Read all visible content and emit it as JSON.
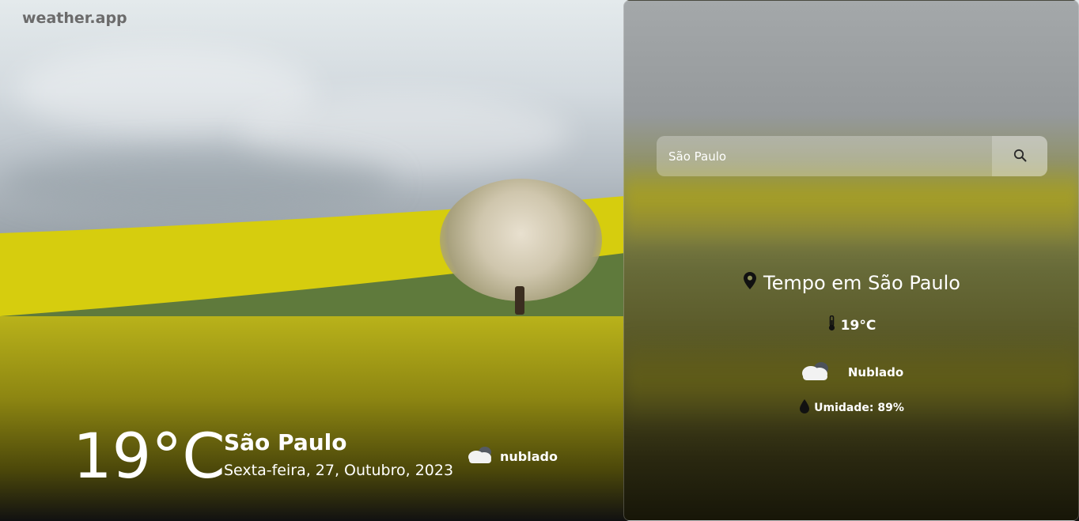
{
  "app": {
    "logo": "weather.app"
  },
  "hero": {
    "temperature": "19°C",
    "city": "São Paulo",
    "date": "Sexta-feira, 27, Outubro, 2023",
    "condition": "nublado",
    "condition_icon": "cloud-icon"
  },
  "panel": {
    "search": {
      "value": "São Paulo",
      "placeholder": "São Paulo",
      "button_icon": "search-icon"
    },
    "title": "Tempo em São Paulo",
    "temperature": "19°C",
    "condition": "Nublado",
    "humidity": "Umidade: 89%"
  },
  "colors": {
    "text": "#ffffff",
    "logo": "#6b6b6b",
    "field_yellow": "#d4cc10"
  }
}
